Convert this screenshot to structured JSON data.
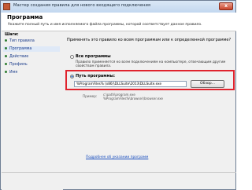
{
  "window": {
    "title": "Мастер создания правила для нового входящего подключения",
    "close_label": "x"
  },
  "header": {
    "title": "Программа",
    "description": "Укажите полный путь и имя исполняемого файла программы, которой соответствует данное правило."
  },
  "steps": {
    "title": "Шаги:",
    "items": [
      {
        "label": "Тип правила",
        "active": false
      },
      {
        "label": "Программа",
        "active": true
      },
      {
        "label": "Действие",
        "active": false
      },
      {
        "label": "Профиль",
        "active": false
      },
      {
        "label": "Имя",
        "active": false
      }
    ]
  },
  "content": {
    "question": "Применять это правило ко всем программам или к определенной программе?",
    "all_programs": {
      "label": "Все программы",
      "description_line1": "Правило применяется ко всем подключениям на компьютере, отвечающим другим",
      "description_line2": "свойствам правила."
    },
    "program_path": {
      "label": "Путь программы:",
      "value": "%ProgramFiles% (x86)\\DLLSuite\\2013\\DLLSuite.exe",
      "browse_label": "Обзор..."
    },
    "example": {
      "label": "Пример:",
      "line1": "c:\\path\\program.exe",
      "line2": "%ProgramFiles%\\browser\\browser.exe"
    },
    "help_link": "Подробнее об указании программ"
  },
  "colors": {
    "highlight_border": "#e0232e",
    "link": "#1a4fbf",
    "step_dot": "#2e7d32"
  }
}
